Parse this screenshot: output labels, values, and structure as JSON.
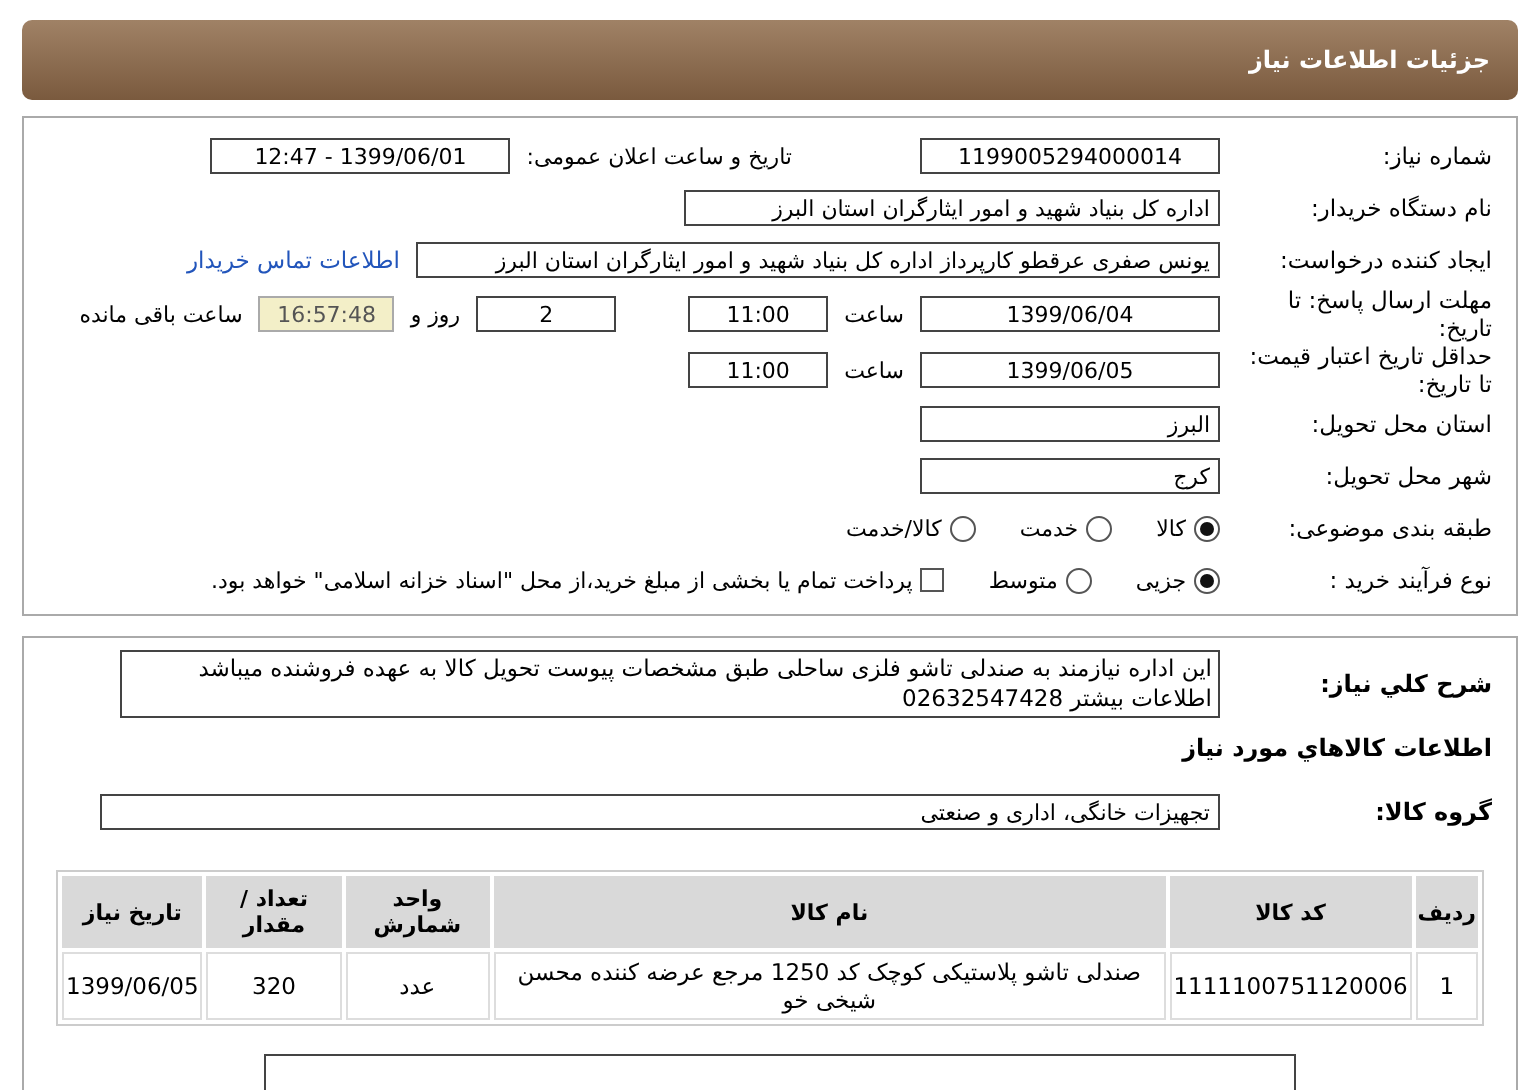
{
  "header": {
    "title": "جزئیات اطلاعات نیاز"
  },
  "need_number": {
    "label": "شماره نیاز:",
    "value": "1199005294000014"
  },
  "announce": {
    "label": "تاریخ و ساعت اعلان عمومی:",
    "value": "1399/06/01 - 12:47"
  },
  "buyer": {
    "label": "نام دستگاه خریدار:",
    "value": "اداره کل بنیاد شهید و امور ایثارگران استان البرز"
  },
  "requester": {
    "label": "ایجاد کننده درخواست:",
    "value": "یونس  صفری عرقطو کارپرداز اداره کل بنیاد شهید و امور ایثارگران استان البرز",
    "link": "اطلاعات تماس خریدار"
  },
  "reply_deadline": {
    "label": "مهلت ارسال پاسخ: تا تاریخ:",
    "date": "1399/06/04",
    "time_label": "ساعت",
    "time": "11:00",
    "days": "2",
    "days_label": "روز و",
    "remaining": "16:57:48",
    "remaining_label": "ساعت باقی مانده"
  },
  "price_validity": {
    "label": "حداقل تاریخ اعتبار قیمت: تا تاریخ:",
    "date": "1399/06/05",
    "time_label": "ساعت",
    "time": "11:00"
  },
  "province": {
    "label": "استان محل تحویل:",
    "value": "البرز"
  },
  "city": {
    "label": "شهر محل تحویل:",
    "value": "کرج"
  },
  "category": {
    "label": "طبقه بندی موضوعی:",
    "options": [
      {
        "label": "کالا",
        "selected": true
      },
      {
        "label": "خدمت",
        "selected": false
      },
      {
        "label": "کالا/خدمت",
        "selected": false
      }
    ]
  },
  "process": {
    "label": "نوع فرآیند خرید :",
    "options": [
      {
        "label": "جزیی",
        "selected": true
      },
      {
        "label": "متوسط",
        "selected": false
      }
    ],
    "payment": {
      "label": "پرداخت تمام یا بخشی از مبلغ خرید،از محل \"اسناد خزانه اسلامی\" خواهد بود.",
      "checked": false
    }
  },
  "description": {
    "label": "شرح کلي نياز:",
    "value": "این اداره نیازمند به صندلی تاشو فلزی ساحلی طبق مشخصات پیوست تحویل کالا به عهده فروشنده میباشد اطلاعات بیشتر 02632547428"
  },
  "goods_title": "اطلاعات کالاهاي مورد نياز",
  "goods_group": {
    "label": "گروه کالا:",
    "value": "تجهیزات خانگی، اداری و صنعتی"
  },
  "table": {
    "columns": [
      "ردیف",
      "کد کالا",
      "نام کالا",
      "واحد شمارش",
      "تعداد / مقدار",
      "تاریخ نیاز"
    ],
    "rows": [
      [
        "1",
        "1111100751120006",
        "صندلی تاشو پلاستیکی کوچک کد 1250 مرجع عرضه کننده محسن شیخی خو",
        "عدد",
        "320",
        "1399/06/05"
      ]
    ]
  }
}
